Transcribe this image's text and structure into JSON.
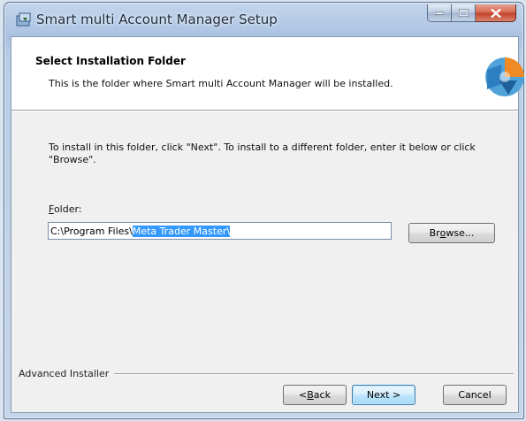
{
  "window": {
    "title": "Smart multi Account Manager Setup",
    "caption_buttons": {
      "minimize": "minimize-icon",
      "maximize": "maximize-icon",
      "close": "close-icon"
    }
  },
  "banner": {
    "title": "Select Installation Folder",
    "subtitle": "This is the folder where Smart multi Account Manager will be installed."
  },
  "instruction": "To install in this folder, click \"Next\". To install to a different folder, enter it below or click \"Browse\".",
  "folder": {
    "label_accel": "F",
    "label_rest": "older:",
    "value_prefix": "C:\\Program Files\\",
    "value_selected": "Meta Trader Master\\"
  },
  "buttons": {
    "browse_pre": "Br",
    "browse_accel": "o",
    "browse_post": "wse...",
    "back_pre": "< ",
    "back_accel": "B",
    "back_post": "ack",
    "next": "Next >",
    "cancel": "Cancel"
  },
  "footer": {
    "installer_label": "Advanced Installer"
  },
  "colors": {
    "accent": "#3399ff",
    "banner_bg": "#ffffff",
    "dialog_bg": "#f0f0f0"
  }
}
